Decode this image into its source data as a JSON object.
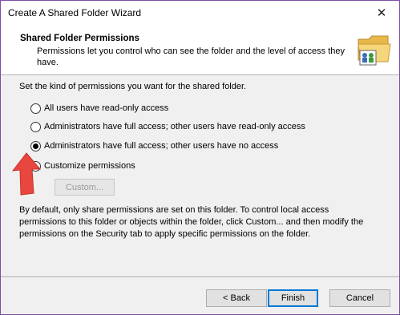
{
  "window": {
    "title": "Create A Shared Folder Wizard"
  },
  "header": {
    "title": "Shared Folder Permissions",
    "description": "Permissions let you control who can see the folder and the level of access they have.",
    "icon": "shared-folder-icon"
  },
  "body": {
    "prompt": "Set the kind of permissions you want for the shared folder.",
    "options": [
      {
        "label": "All users have read-only access",
        "selected": false
      },
      {
        "label": "Administrators have full access; other users have read-only access",
        "selected": false
      },
      {
        "label": "Administrators have full access; other users have no access",
        "selected": true
      },
      {
        "label": "Customize permissions",
        "selected": false
      }
    ],
    "custom_button": "Custom...",
    "info": "By default, only share permissions are set on this folder. To control local access permissions to this folder or objects within the folder, click Custom... and then modify the permissions on the Security tab to apply specific permissions on the folder."
  },
  "footer": {
    "back": "< Back",
    "finish": "Finish",
    "cancel": "Cancel"
  },
  "annotation": {
    "icon": "red-arrow-icon",
    "color": "#e8473f"
  }
}
